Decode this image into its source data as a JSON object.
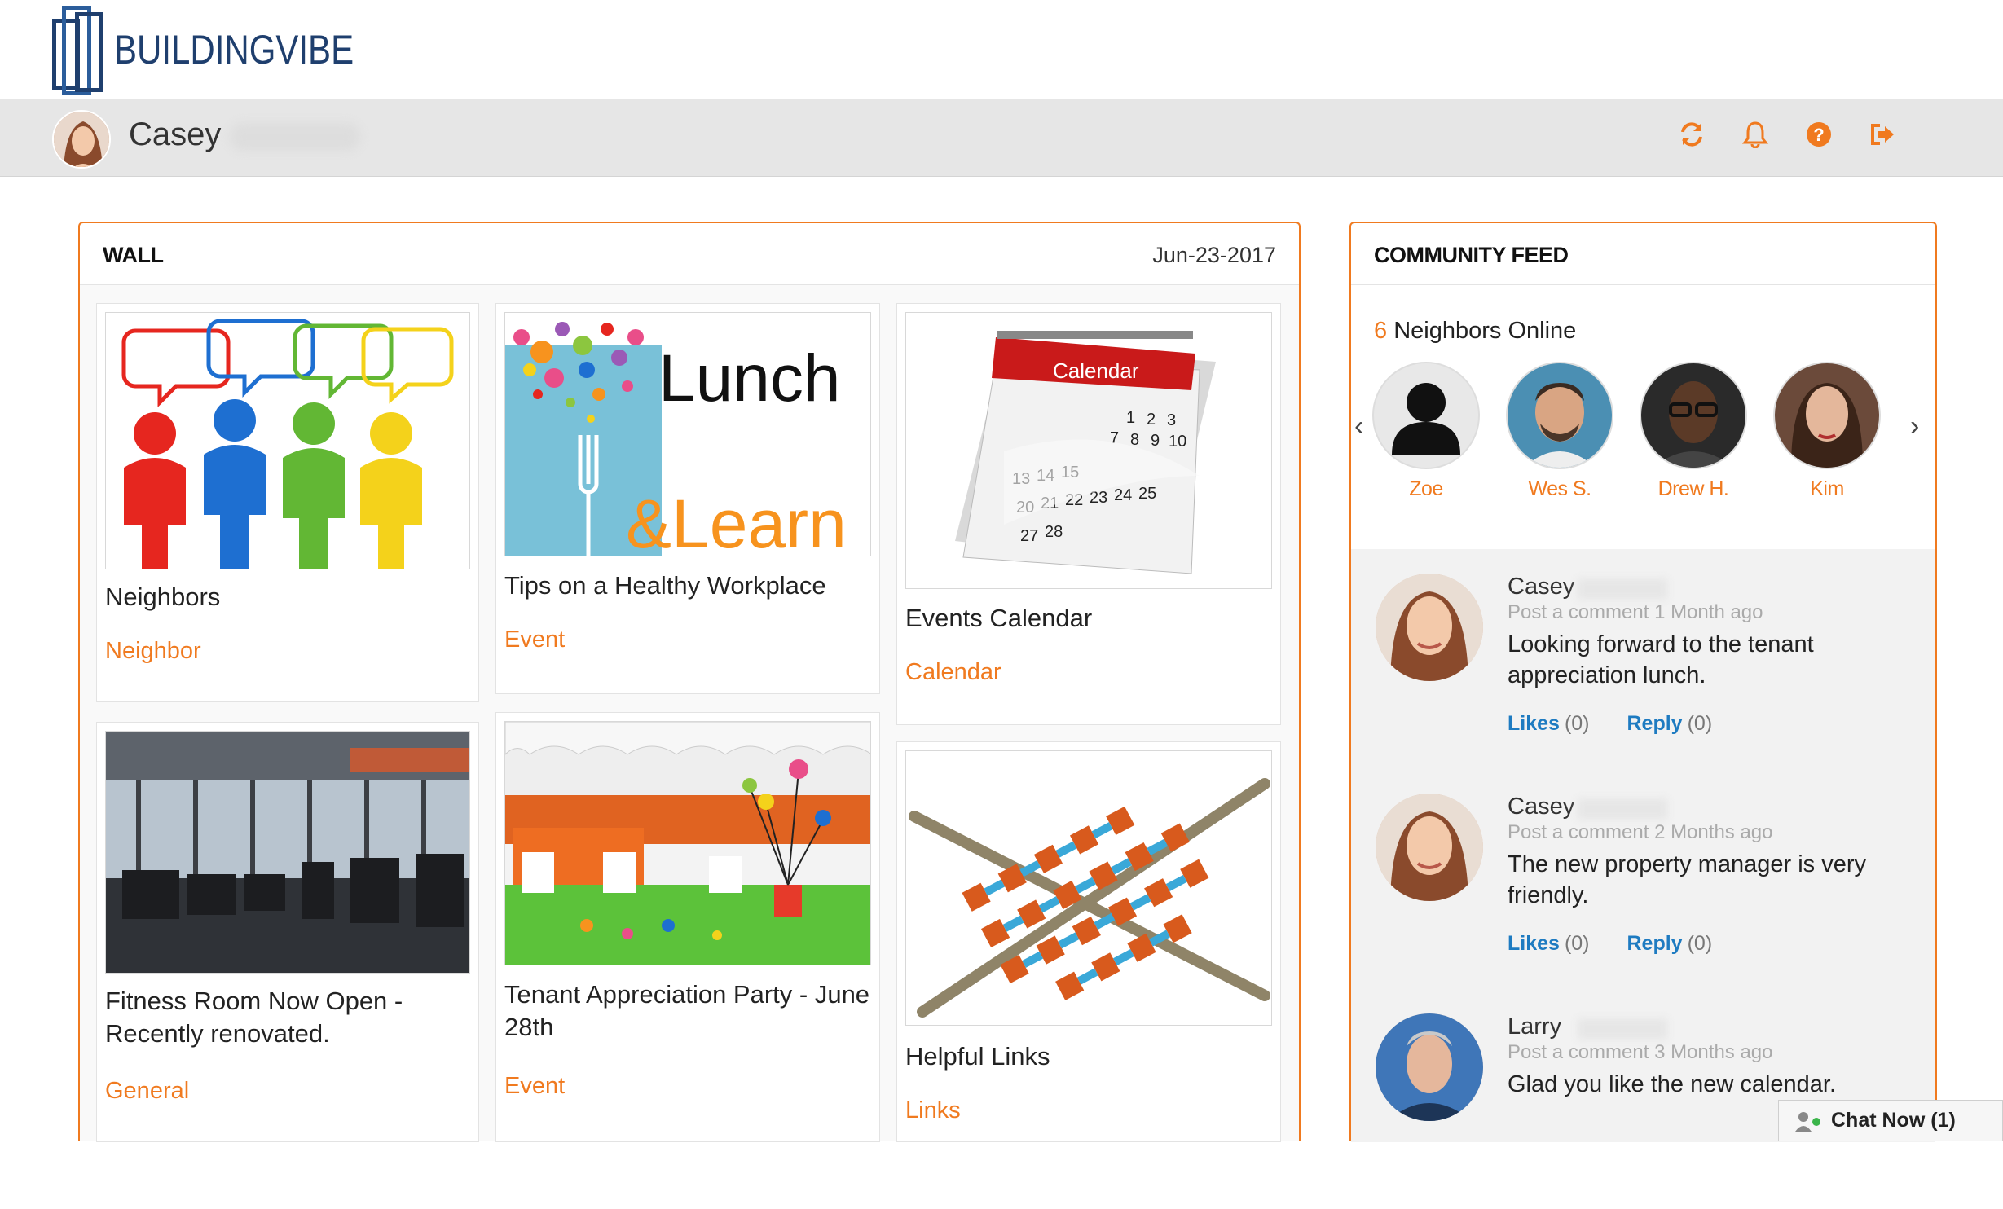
{
  "brand": {
    "name": "BUILDINGVIBE",
    "color": "#1f3f6e",
    "accent": "#f07a1f",
    "link": "#1e7bc1"
  },
  "user": {
    "name": "Casey"
  },
  "header_icons": [
    "refresh-icon",
    "bell-icon",
    "help-icon",
    "logout-icon"
  ],
  "wall": {
    "title": "WALL",
    "date": "Jun-23-2017",
    "cards": [
      {
        "title": "Neighbors",
        "category": "Neighbor",
        "image": "neighbors-illustration"
      },
      {
        "title": "Tips on a Healthy Workplace",
        "category": "Event",
        "image": "lunch-and-learn-graphic",
        "image_text_1": "Lunch",
        "image_text_2": "&Learn"
      },
      {
        "title": "Events Calendar",
        "category": "Calendar",
        "image": "calendar-illustration",
        "image_text": "Calendar"
      },
      {
        "title_line1": "Fitness Room Now Open -",
        "title_line2": "Recently renovated.",
        "category": "General",
        "image": "fitness-room-photo"
      },
      {
        "title_line1": "Tenant Appreciation Party - June",
        "title_line2": "28th",
        "category": "Event",
        "image": "party-tables-photo"
      },
      {
        "title": "Helpful Links",
        "category": "Links",
        "image": "network-grid-illustration"
      }
    ]
  },
  "feed": {
    "title": "COMMUNITY FEED",
    "online_count": "6",
    "online_label": "Neighbors Online",
    "people": [
      {
        "name": "Zoe",
        "avatar": "default-avatar"
      },
      {
        "name": "Wes S.",
        "avatar": "photo"
      },
      {
        "name": "Drew H.",
        "avatar": "photo"
      },
      {
        "name": "Kim",
        "avatar": "photo"
      }
    ],
    "comments": [
      {
        "name": "Casey",
        "meta": "Post a comment 1 Month ago",
        "text": "Looking forward to the tenant appreciation lunch.",
        "likes_label": "Likes",
        "likes": "(0)",
        "reply_label": "Reply",
        "replies": "(0)"
      },
      {
        "name": "Casey",
        "meta": "Post a comment 2 Months ago",
        "text": "The new property manager is very friendly.",
        "likes_label": "Likes",
        "likes": "(0)",
        "reply_label": "Reply",
        "replies": "(0)"
      },
      {
        "name": "Larry",
        "meta": "Post a comment 3 Months ago",
        "text": "Glad you like the new calendar."
      }
    ]
  },
  "chat": {
    "label": "Chat Now (1)"
  }
}
